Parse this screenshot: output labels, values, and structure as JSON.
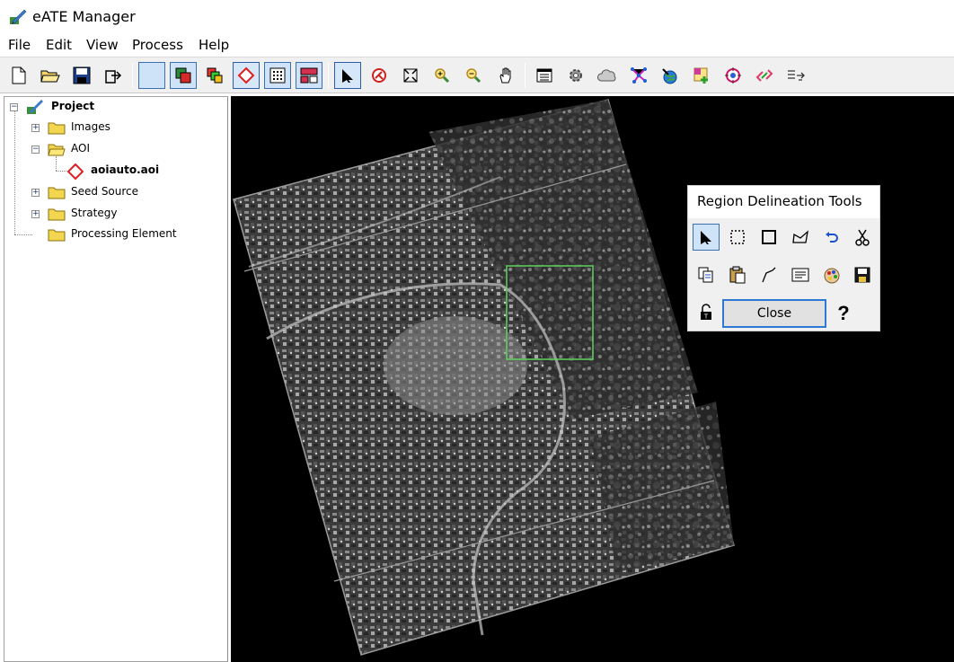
{
  "window": {
    "title": "eATE Manager",
    "icon": "app-pen-icon"
  },
  "menu": [
    "File",
    "Edit",
    "View",
    "Process",
    "Help"
  ],
  "toolbar": {
    "buttons": [
      {
        "name": "new-file-icon"
      },
      {
        "name": "open-folder-icon"
      },
      {
        "name": "save-icon"
      },
      {
        "name": "export-icon"
      },
      {
        "name": "blank-view-icon"
      },
      {
        "name": "layers-red-icon"
      },
      {
        "name": "layers-color-icon"
      },
      {
        "name": "aoi-diamond-icon"
      },
      {
        "name": "grid-icon"
      },
      {
        "name": "split-view-icon"
      },
      {
        "name": "select-arrow-icon"
      },
      {
        "name": "roam-icon"
      },
      {
        "name": "fit-extent-icon"
      },
      {
        "name": "zoom-in-icon"
      },
      {
        "name": "zoom-out-icon"
      },
      {
        "name": "pan-hand-icon"
      },
      {
        "name": "table-icon"
      },
      {
        "name": "settings-gear-icon"
      },
      {
        "name": "cloud-icon"
      },
      {
        "name": "network-icon"
      },
      {
        "name": "globe-icon"
      },
      {
        "name": "add-layer-icon"
      },
      {
        "name": "target-icon"
      },
      {
        "name": "link-icon"
      },
      {
        "name": "transfer-icon"
      }
    ]
  },
  "tree": {
    "root": "Project",
    "images": "Images",
    "aoi": "AOI",
    "aoi_file": "aoiauto.aoi",
    "seed_source": "Seed Source",
    "strategy": "Strategy",
    "processing_element": "Processing Element"
  },
  "dialog": {
    "title": "Region Delineation Tools",
    "close_label": "Close",
    "help_label": "?",
    "tools_row1": [
      "select-arrow-icon",
      "dashed-rect-icon",
      "rect-icon",
      "polygon-icon",
      "undo-icon",
      "cut-scissors-icon"
    ],
    "tools_row2": [
      "copy-icon",
      "paste-icon",
      "polyline-icon",
      "attributes-icon",
      "palette-icon",
      "save-icon"
    ],
    "lock": "lock-icon"
  },
  "colors": {
    "selection_box": "#5fd35f",
    "accent": "#2f78d4",
    "aoi_red": "#e02020"
  }
}
